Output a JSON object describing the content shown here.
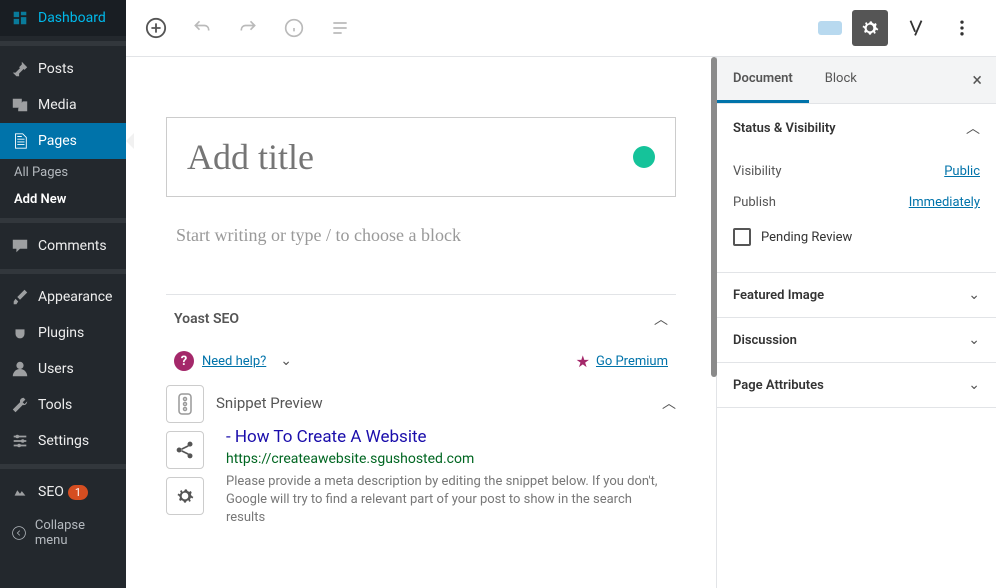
{
  "sidebar": {
    "items": [
      {
        "label": "Dashboard",
        "icon": "dashboard"
      },
      {
        "label": "Posts",
        "icon": "pin"
      },
      {
        "label": "Media",
        "icon": "media"
      },
      {
        "label": "Pages",
        "icon": "pages",
        "active": true
      },
      {
        "label": "Comments",
        "icon": "comment"
      },
      {
        "label": "Appearance",
        "icon": "brush"
      },
      {
        "label": "Plugins",
        "icon": "plug"
      },
      {
        "label": "Users",
        "icon": "user"
      },
      {
        "label": "Tools",
        "icon": "wrench"
      },
      {
        "label": "Settings",
        "icon": "sliders"
      },
      {
        "label": "SEO",
        "icon": "seo",
        "badge": "1"
      }
    ],
    "subitems": [
      {
        "label": "All Pages"
      },
      {
        "label": "Add New",
        "bold": true
      }
    ],
    "collapse": "Collapse menu"
  },
  "topbar": {
    "save": "",
    "publish": ""
  },
  "editor": {
    "title_placeholder": "Add title",
    "content_prompt": "Start writing or type / to choose a block"
  },
  "yoast": {
    "title": "Yoast SEO",
    "help": "Need help?",
    "premium": "Go Premium",
    "snippet_label": "Snippet Preview",
    "snippet_title": "- How To Create A Website",
    "snippet_url": "https://createawebsite.sgushosted.com",
    "snippet_desc": "Please provide a meta description by editing the snippet below. If you don't, Google will try to find a relevant part of your post to show in the search results"
  },
  "panel": {
    "tabs": [
      {
        "label": "Document",
        "active": true
      },
      {
        "label": "Block"
      }
    ],
    "sections": [
      {
        "label": "Status & Visibility",
        "open": true,
        "rows": [
          {
            "label": "Visibility",
            "value": "Public"
          },
          {
            "label": "Publish",
            "value": "Immediately"
          }
        ],
        "pending": "Pending Review"
      },
      {
        "label": "Featured Image"
      },
      {
        "label": "Discussion"
      },
      {
        "label": "Page Attributes"
      }
    ]
  }
}
